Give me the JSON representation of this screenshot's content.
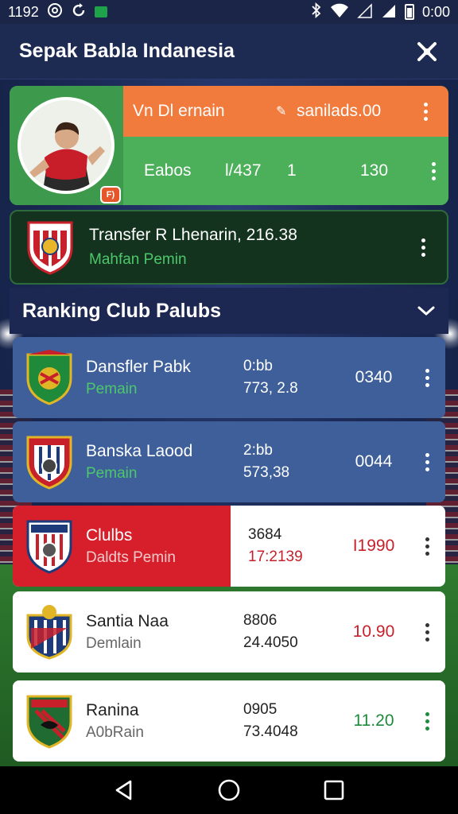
{
  "status_bar": {
    "time_left": "1192",
    "time_right": "0:00"
  },
  "app_bar": {
    "title": "Sepak Babla Indanesia"
  },
  "player_card": {
    "badge": "F)",
    "top_label": "Vn Dl ernain",
    "top_value": "sanilads.00",
    "row_label": "Eabos",
    "row_col1": "l/437",
    "row_col2": "1",
    "row_col3": "130"
  },
  "transfer": {
    "title": "Transfer R Lhenarin, 216.38",
    "subtitle": "Mahfan Pemin"
  },
  "ranking": {
    "title": "Ranking Club Palubs",
    "clubs": [
      {
        "name": "Dansfler Pabk",
        "sub": "Pemain",
        "stat1": "0:bb",
        "stat2": "773, 2.8",
        "score": "0340"
      },
      {
        "name": "Banska Laood",
        "sub": "Pemain",
        "stat1": "2:bb",
        "stat2": "573,38",
        "score": "0044"
      },
      {
        "name": "Clulbs",
        "sub": "Daldts Pemin",
        "stat1": "3684",
        "stat2": "17:2139",
        "score": "I1990"
      },
      {
        "name": "Santia Naa",
        "sub": "Demlain",
        "stat1": "8806",
        "stat2": "24.4050",
        "score": "10.90"
      },
      {
        "name": "Ranina",
        "sub": "A0bRain",
        "stat1": "0905",
        "stat2": "73.4048",
        "score": "11.20"
      }
    ]
  },
  "colors": {
    "header_bg": "#1d2a52",
    "orange": "#f07b3c",
    "green": "#4caf5a",
    "row_blue": "#3e5f9a",
    "red": "#d71f2b",
    "score_red": "#c8202a",
    "score_green": "#1e8a3c"
  }
}
